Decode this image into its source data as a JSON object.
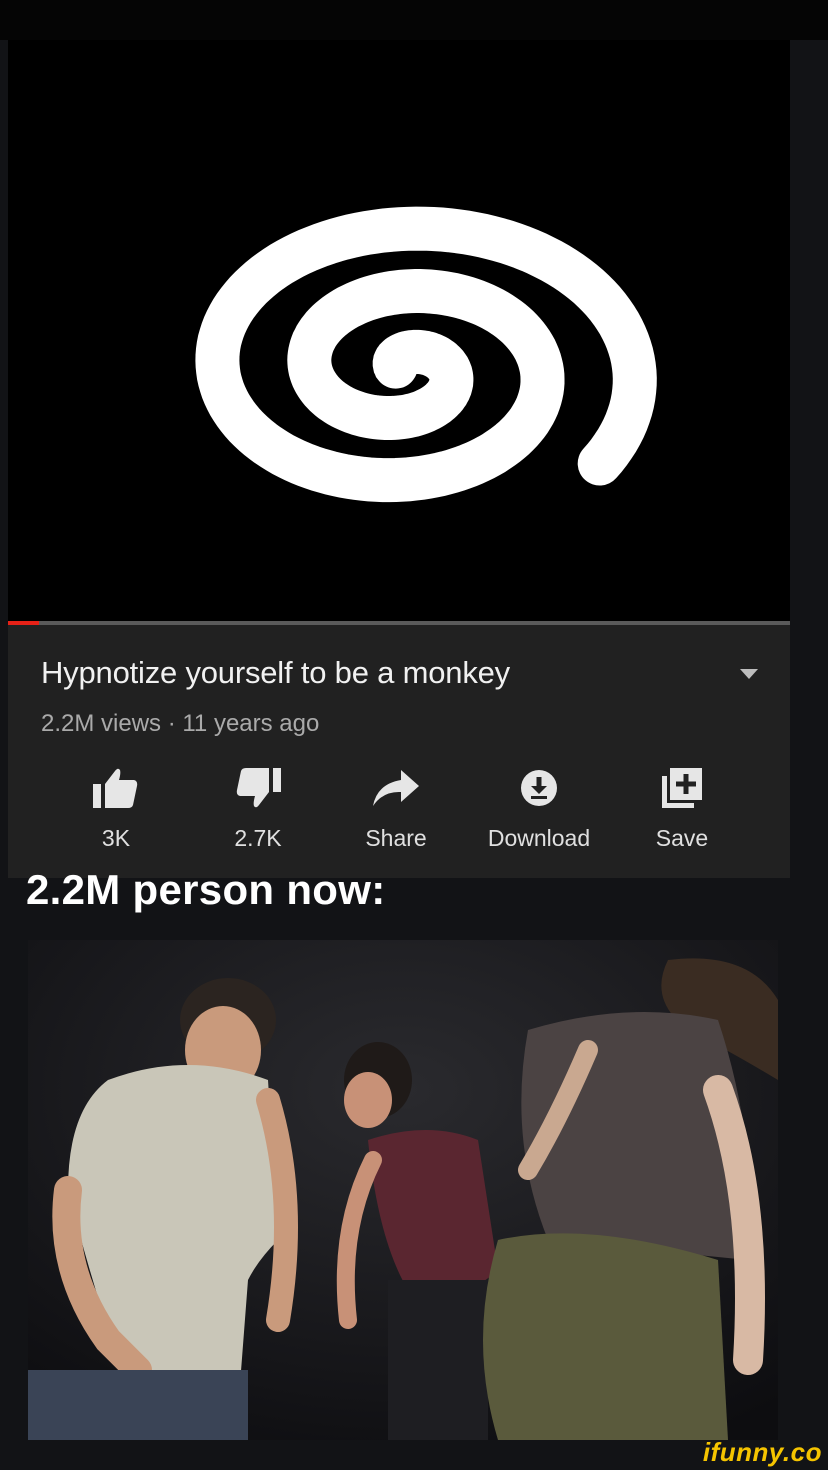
{
  "video": {
    "title": "Hypnotize yourself to be a monkey",
    "meta": "2.2M views · 11 years ago",
    "progress_fraction": 0.04
  },
  "actions": [
    {
      "label": "3K",
      "icon": "thumbs-up-icon"
    },
    {
      "label": "2.7K",
      "icon": "thumbs-down-icon"
    },
    {
      "label": "Share",
      "icon": "share-icon"
    },
    {
      "label": "Download",
      "icon": "download-icon"
    },
    {
      "label": "Save",
      "icon": "save-playlist-icon"
    }
  ],
  "caption": "2.2M person now:",
  "watermark": "ifunny.co",
  "colors": {
    "progress": "#e62117",
    "panel": "#212121",
    "watermark": "#f5c400"
  }
}
